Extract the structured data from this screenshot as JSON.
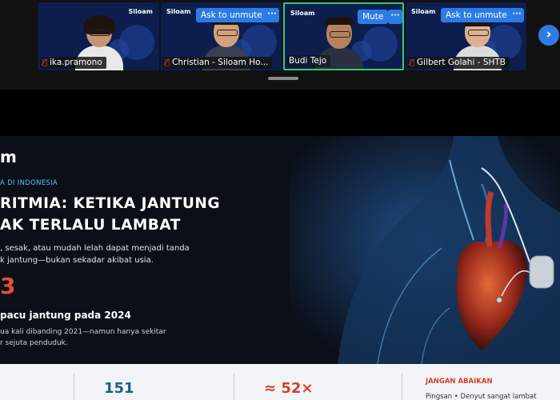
{
  "participants": [
    {
      "name": "ika.pramono",
      "brand": "Siloam",
      "button": "",
      "active": false
    },
    {
      "name": "Christian - Siloam Ho...",
      "brand": "Siloam",
      "button": "Ask to unmute",
      "active": false
    },
    {
      "name": "Budi Tejo",
      "brand": "Siloam",
      "button": "Mute",
      "active": true
    },
    {
      "name": "Gilbert Golahi - SHTB",
      "brand": "Siloam",
      "button": "Ask to unmute",
      "active": false
    }
  ],
  "more_label": "···",
  "mic_off_icon": "mic-off-icon",
  "next_label": "›",
  "slide": {
    "logo": "m",
    "kicker": "A DI INDONESIA",
    "title_line1": "RITMIA: KETIKA JANTUNG",
    "title_line2": "AK TERLALU LAMBAT",
    "desc_line1": ", sesak, atau mudah lelah dapat menjadi tanda",
    "desc_line2": "k jantung—bukan sekadar akibat usia.",
    "big_number": "3",
    "sub_heading": "pacu jantung pada 2024",
    "note_line1": "ua kali dibanding 2021—namun hanya sekitar",
    "note_line2": "r sejuta penduduk.",
    "stat1": "151",
    "stat2": "≈ 52×",
    "warning_title": "JANGAN ABAIKAN",
    "warning_detail": "Pingsan  •  Denyut sangat lambat"
  },
  "colors": {
    "accent_blue": "#2d7be5",
    "active_border": "#35c977",
    "stat_red": "#d2432a"
  }
}
